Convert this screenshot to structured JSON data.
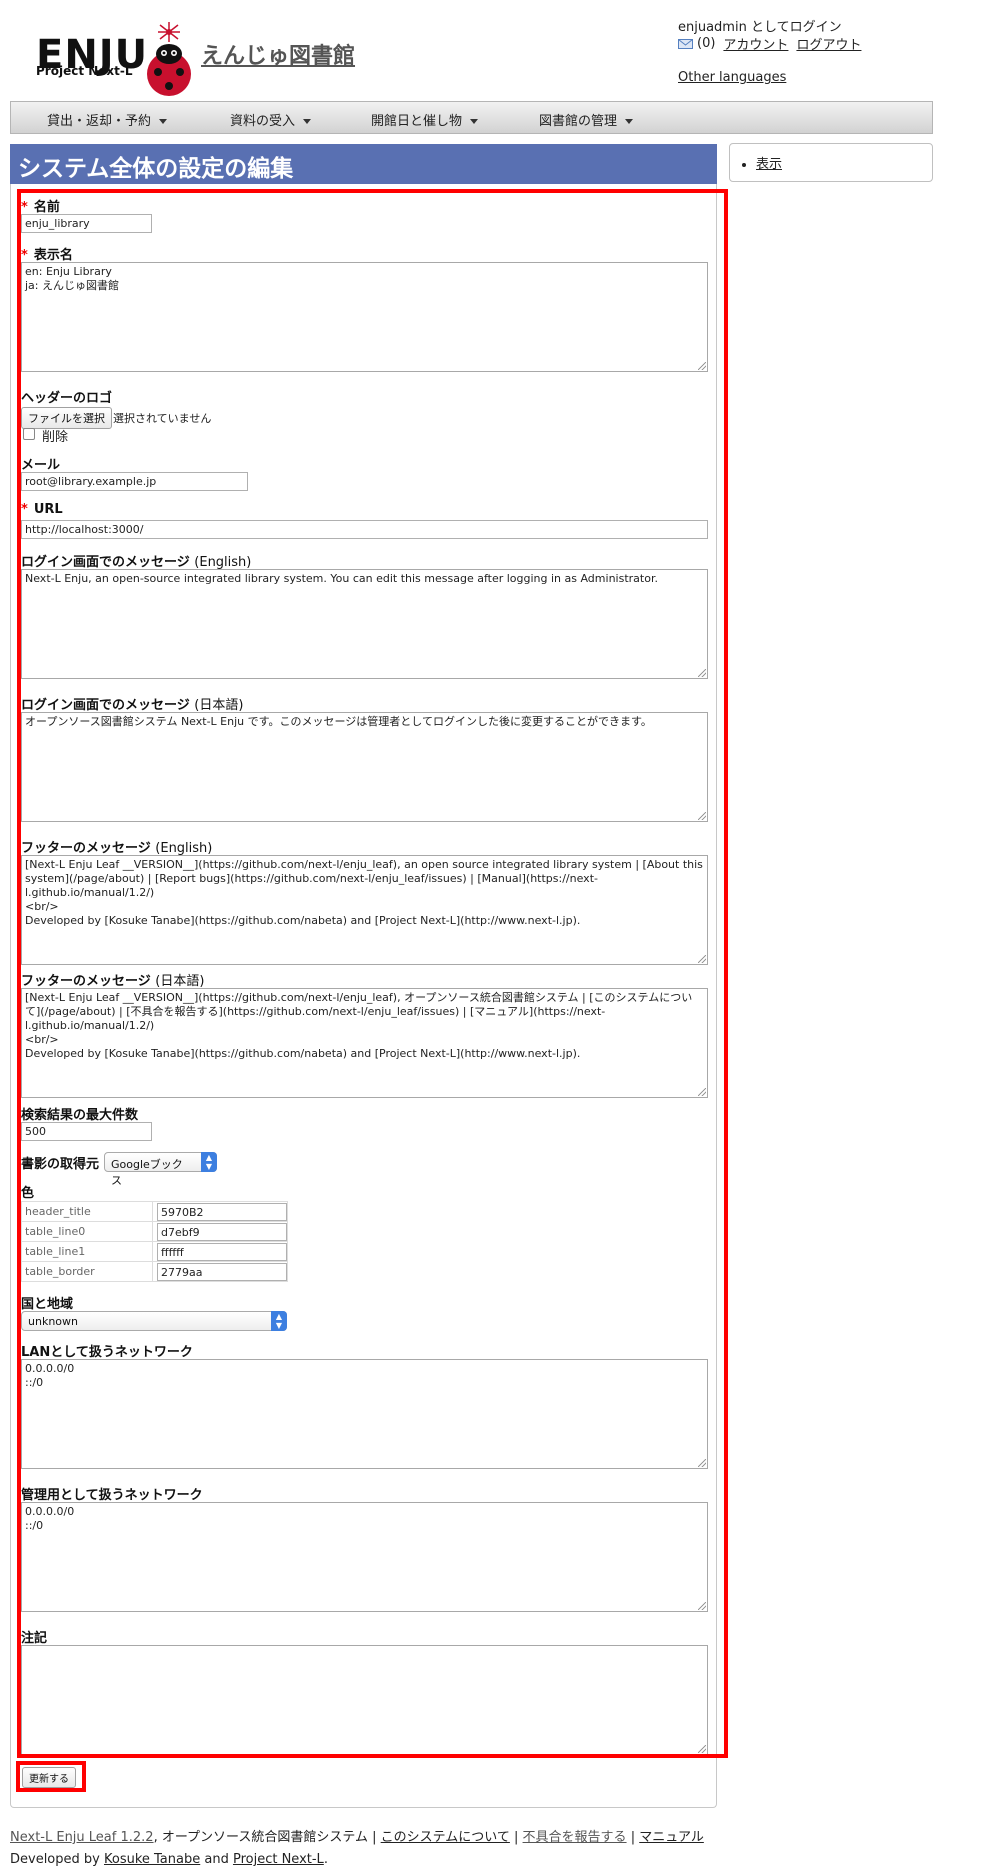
{
  "header": {
    "logo_text": "ENJU",
    "logo_subtext": "Project Next-L",
    "site_name": "えんじゅ図書館",
    "login_status": "enjuadmin としてログイン",
    "message_count": "(0)",
    "account_link": "アカウント",
    "logout_link": "ログアウト",
    "other_languages": "Other languages"
  },
  "nav": {
    "items": [
      {
        "label": "貸出・返却・予約"
      },
      {
        "label": "資料の受入"
      },
      {
        "label": "開館日と催し物"
      },
      {
        "label": "図書館の管理"
      }
    ]
  },
  "page": {
    "title": "システム全体の設定の編集"
  },
  "sidebar": {
    "show_link": "表示"
  },
  "form": {
    "required_mark": "*",
    "name_label": "名前",
    "name_value": "enju_library",
    "display_name_label": "表示名",
    "display_name_value": "en: Enju Library\nja: えんじゅ図書館",
    "header_logo_label": "ヘッダーのロゴ",
    "file_button": "ファイルを選択",
    "file_status": "選択されていません",
    "delete_label": "削除",
    "email_label": "メール",
    "email_value": "root@library.example.jp",
    "url_label": "URL",
    "url_value": "http://localhost:3000/",
    "login_msg_en_label": "ログイン画面でのメッセージ",
    "login_msg_en_lang": "(English)",
    "login_msg_en_value": "Next-L Enju, an open-source integrated library system. You can edit this message after logging in as Administrator.",
    "login_msg_ja_label": "ログイン画面でのメッセージ",
    "login_msg_ja_lang": "(日本語)",
    "login_msg_ja_value": "オープンソース図書館システム Next-L Enju です。このメッセージは管理者としてログインした後に変更することができます。",
    "footer_msg_en_label": "フッターのメッセージ",
    "footer_msg_en_lang": "(English)",
    "footer_msg_en_value": "[Next-L Enju Leaf __VERSION__](https://github.com/next-l/enju_leaf), an open source integrated library system | [About this system](/page/about) | [Report bugs](https://github.com/next-l/enju_leaf/issues) | [Manual](https://next-l.github.io/manual/1.2/)\n<br/>\nDeveloped by [Kosuke Tanabe](https://github.com/nabeta) and [Project Next-L](http://www.next-l.jp).",
    "footer_msg_ja_label": "フッターのメッセージ",
    "footer_msg_ja_lang": "(日本語)",
    "footer_msg_ja_value": "[Next-L Enju Leaf __VERSION__](https://github.com/next-l/enju_leaf), オープンソース統合図書館システム | [このシステムについて](/page/about) | [不具合を報告する](https://github.com/next-l/enju_leaf/issues) | [マニュアル](https://next-l.github.io/manual/1.2/)\n<br/>\nDeveloped by [Kosuke Tanabe](https://github.com/nabeta) and [Project Next-L](http://www.next-l.jp).",
    "max_results_label": "検索結果の最大件数",
    "max_results_value": "500",
    "book_jacket_label": "書影の取得元",
    "book_jacket_value": "Googleブックス",
    "color_label": "色",
    "colors": [
      {
        "key": "header_title",
        "value": "5970B2"
      },
      {
        "key": "table_line0",
        "value": "d7ebf9"
      },
      {
        "key": "table_line1",
        "value": "ffffff"
      },
      {
        "key": "table_border",
        "value": "2779aa"
      }
    ],
    "country_label": "国と地域",
    "country_value": "unknown",
    "lan_label": "LANとして扱うネットワーク",
    "lan_value": "0.0.0.0/0\n::/0",
    "admin_net_label": "管理用として扱うネットワーク",
    "admin_net_value": "0.0.0.0/0\n::/0",
    "note_label": "注記",
    "note_value": "",
    "submit_button": "更新する"
  },
  "footer": {
    "product_link": "Next-L Enju Leaf 1.2.2",
    "product_desc": ", オープンソース統合図書館システム | ",
    "about_link": "このシステムについて",
    "sep": " | ",
    "bugs_link": "不具合を報告する",
    "manual_link": "マニュアル",
    "developed_by": "Developed by ",
    "author_link": "Kosuke Tanabe",
    "and": " and ",
    "project_link": "Project Next-L",
    "period": "."
  },
  "colors": {
    "title_bar": "#5970B2",
    "highlight": "#ff0000",
    "logo_red": "#c8102e"
  }
}
